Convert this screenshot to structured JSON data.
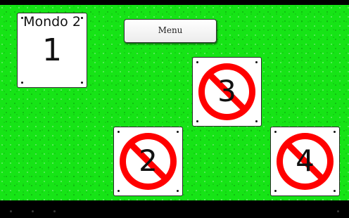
{
  "world": {
    "title": "Mondo 2",
    "number": "1"
  },
  "menu": {
    "label": "Menu"
  },
  "levels": [
    {
      "number": "3",
      "locked": true
    },
    {
      "number": "2",
      "locked": true
    },
    {
      "number": "4",
      "locked": true
    }
  ],
  "colors": {
    "background": "#16e416",
    "prohibition": "#ff0000"
  },
  "icons": {
    "lock": "prohibition-sign-icon"
  }
}
